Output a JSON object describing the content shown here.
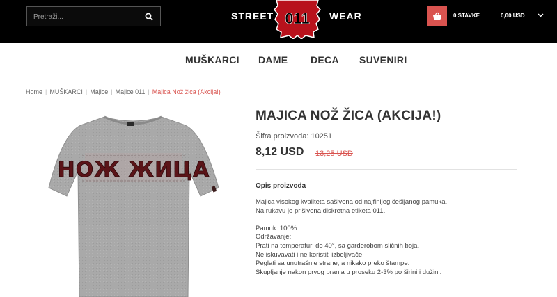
{
  "header": {
    "search_placeholder": "Pretraži...",
    "brand_left": "STREET",
    "logo_text": "011",
    "brand_right": "WEAR",
    "cart_count": "0 STAVKE",
    "cart_total": "0,00 USD",
    "accent_color": "#d9534f"
  },
  "nav": {
    "items": [
      "MUŠKARCI",
      "DAME",
      "DECA",
      "SUVENIRI"
    ]
  },
  "breadcrumb": {
    "items": [
      "Home",
      "MUŠKARCI",
      "Majice",
      "Majice 011"
    ],
    "current": "Majica Nož žica (Akcija!)"
  },
  "product": {
    "image_text": "НОЖ ЖИЦА",
    "title": "MAJICA NOŽ ŽICA (AKCIJA!)",
    "sku": "Šifra proizvoda: 10251",
    "price": "8,12 USD",
    "old_price": "13,25 USD",
    "description_title": "Opis proizvoda",
    "description_lines": [
      "Majica visokog kvaliteta sašivena od najfinijeg češljanog pamuka.",
      "Na rukavu je prišivena diskretna etiketa 011.",
      "",
      "Pamuk: 100%",
      "Održavanje:",
      "Prati na temperaturi do 40°, sa garderobom sličnih boja.",
      "Ne iskuvavati i ne koristiti izbeljivače.",
      "Peglati sa unutrašnje strane, a nikako preko štampe.",
      "Skupljanje nakon prvog pranja u proseku 2-3% po širini i dužini."
    ]
  }
}
